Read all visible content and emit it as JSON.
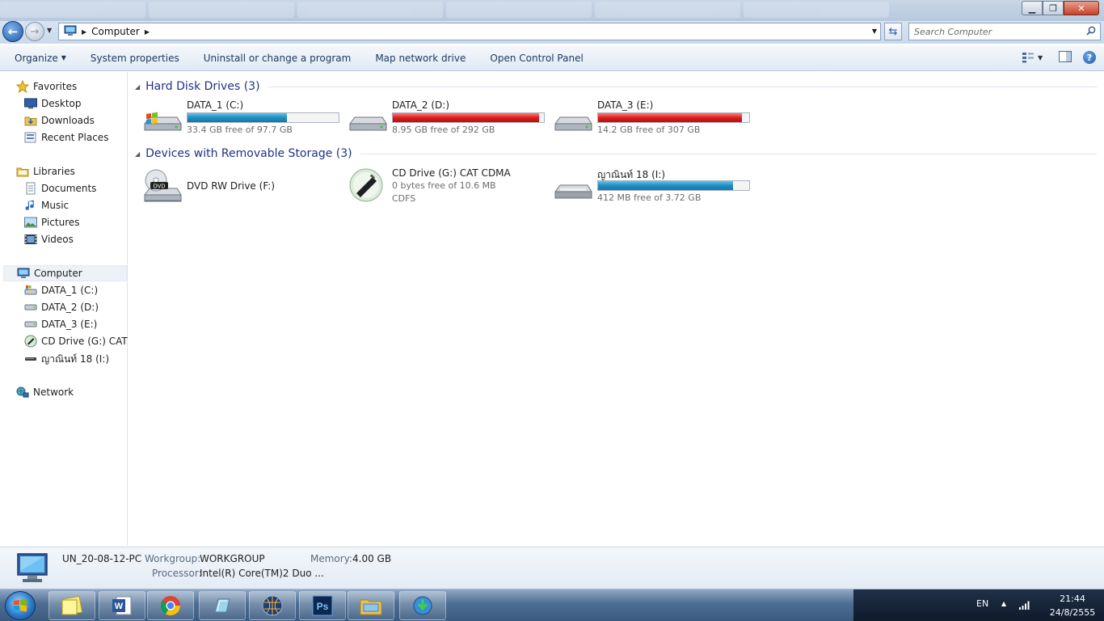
{
  "window": {
    "background_tabs": [
      "",
      "",
      "",
      "",
      "",
      "",
      ""
    ]
  },
  "address": {
    "location": "Computer",
    "search_placeholder": "Search Computer"
  },
  "toolbar": {
    "organize": "Organize",
    "system_properties": "System properties",
    "uninstall": "Uninstall or change a program",
    "map_drive": "Map network drive",
    "control_panel": "Open Control Panel"
  },
  "sidebar": {
    "favorites": "Favorites",
    "desktop": "Desktop",
    "downloads": "Downloads",
    "recent": "Recent Places",
    "libraries": "Libraries",
    "documents": "Documents",
    "music": "Music",
    "pictures": "Pictures",
    "videos": "Videos",
    "computer": "Computer",
    "drive_c": "DATA_1 (C:)",
    "drive_d": "DATA_2 (D:)",
    "drive_e": "DATA_3 (E:)",
    "drive_g": "CD Drive (G:) CAT C",
    "drive_i": "ญาณินท์ 18 (I:)",
    "network": "Network"
  },
  "groups": {
    "hdd": "Hard Disk Drives (3)",
    "removable": "Devices with Removable Storage (3)"
  },
  "drives": {
    "c": {
      "name": "DATA_1 (C:)",
      "free": "33.4 GB free of 97.7 GB",
      "used_fraction": 0.658,
      "color": "#1e8dc3"
    },
    "d": {
      "name": "DATA_2 (D:)",
      "free": "8.95 GB free of 292 GB",
      "used_fraction": 0.969,
      "color": "#de1e1e"
    },
    "e": {
      "name": "DATA_3 (E:)",
      "free": "14.2 GB free of 307 GB",
      "used_fraction": 0.954,
      "color": "#de1e1e"
    },
    "f": {
      "name": "DVD RW Drive (F:)"
    },
    "g": {
      "name": "CD Drive (G:) CAT CDMA",
      "free": "0 bytes free of 10.6 MB",
      "fs": "CDFS"
    },
    "i": {
      "name": "ญาณินท์ 18 (I:)",
      "free": "412 MB free of 3.72 GB",
      "used_fraction": 0.892,
      "color": "#1e8dc3"
    }
  },
  "details": {
    "pc_name": "UN_20-08-12-PC",
    "workgroup_label": "Workgroup:",
    "workgroup": "WORKGROUP",
    "memory_label": "Memory:",
    "memory": "4.00 GB",
    "processor_label": "Processor:",
    "processor": "Intel(R) Core(TM)2 Duo ..."
  },
  "taskbar": {
    "lang": "EN",
    "time": "21:44",
    "date": "24/8/2555",
    "ps_label": "Ps",
    "dvd_label": "DVD"
  }
}
